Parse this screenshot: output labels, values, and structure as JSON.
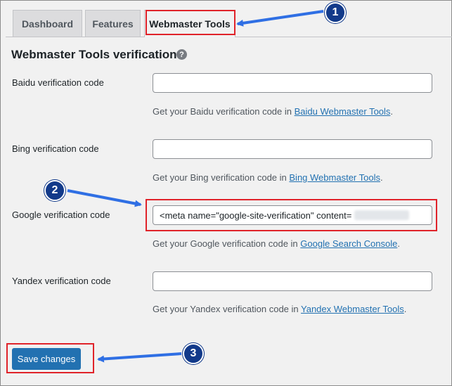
{
  "tabs": [
    {
      "label": "Dashboard",
      "active": false
    },
    {
      "label": "Features",
      "active": false
    },
    {
      "label": "Webmaster Tools",
      "active": true
    }
  ],
  "section": {
    "title": "Webmaster Tools verification",
    "help_icon": "question-circle-icon"
  },
  "fields": [
    {
      "label": "Baidu verification code",
      "value": "",
      "desc_prefix": "Get your Baidu verification code in ",
      "link": "Baidu Webmaster Tools",
      "desc_suffix": "."
    },
    {
      "label": "Bing verification code",
      "value": "",
      "desc_prefix": "Get your Bing verification code in ",
      "link": "Bing Webmaster Tools",
      "desc_suffix": "."
    },
    {
      "label": "Google verification code",
      "value": "<meta name=\"google-site-verification\" content=",
      "desc_prefix": "Get your Google verification code in ",
      "link": "Google Search Console",
      "desc_suffix": "."
    },
    {
      "label": "Yandex verification code",
      "value": "",
      "desc_prefix": "Get your Yandex verification code in ",
      "link": "Yandex Webmaster Tools",
      "desc_suffix": "."
    }
  ],
  "save_button": {
    "label": "Save changes"
  },
  "annotations": {
    "step1": "1",
    "step2": "2",
    "step3": "3",
    "highlight_color": "#e0232a",
    "arrow_color": "#2f6fe4"
  },
  "colors": {
    "primary": "#2271b1",
    "link": "#2271b1",
    "background": "#f1f1f1"
  }
}
